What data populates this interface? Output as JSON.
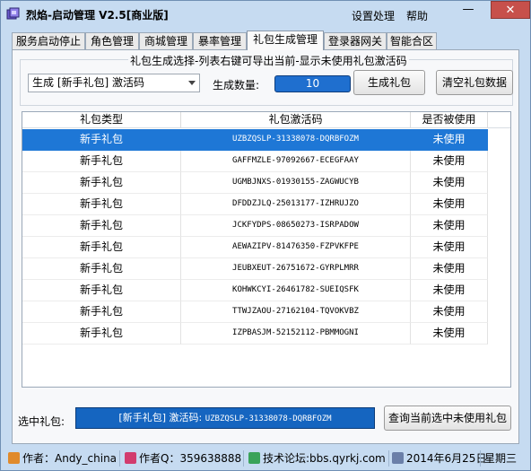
{
  "window": {
    "title": "烈焰-启动管理 V2.5[商业版]",
    "menu": [
      "设置处理",
      "帮助"
    ],
    "minimize_glyph": "—",
    "close_glyph": "✕"
  },
  "tabs": [
    {
      "label": "服务启动停止",
      "active": false
    },
    {
      "label": "角色管理",
      "active": false
    },
    {
      "label": "商城管理",
      "active": false
    },
    {
      "label": "暴率管理",
      "active": false
    },
    {
      "label": "礼包生成管理",
      "active": true
    },
    {
      "label": "登录器网关",
      "active": false
    },
    {
      "label": "智能合区",
      "active": false
    }
  ],
  "gift": {
    "group_title": "礼包生成选择-列表右键可导出当前-显示未使用礼包激活码",
    "type_selected": "生成 [新手礼包] 激活码",
    "qty_label": "生成数量:",
    "qty_value": "10",
    "generate_button": "生成礼包",
    "clear_button": "清空礼包数据"
  },
  "table": {
    "columns": [
      "礼包类型",
      "礼包激活码",
      "是否被使用"
    ],
    "rows": [
      {
        "type": "新手礼包",
        "code": "UZBZQSLP-31338078-DQRBFOZM",
        "used": "未使用"
      },
      {
        "type": "新手礼包",
        "code": "GAFFMZLE-97092667-ECEGFAAY",
        "used": "未使用"
      },
      {
        "type": "新手礼包",
        "code": "UGMBJNXS-01930155-ZAGWUCYB",
        "used": "未使用"
      },
      {
        "type": "新手礼包",
        "code": "DFDDZJLQ-25013177-IZHRUJZO",
        "used": "未使用"
      },
      {
        "type": "新手礼包",
        "code": "JCKFYDPS-08650273-ISRPADOW",
        "used": "未使用"
      },
      {
        "type": "新手礼包",
        "code": "AEWAZIPV-81476350-FZPVKFPE",
        "used": "未使用"
      },
      {
        "type": "新手礼包",
        "code": "JEUBXEUT-26751672-GYRPLMRR",
        "used": "未使用"
      },
      {
        "type": "新手礼包",
        "code": "KOHWKCYI-26461782-SUEIQSFK",
        "used": "未使用"
      },
      {
        "type": "新手礼包",
        "code": "TTWJZAOU-27162104-TQVOKVBZ",
        "used": "未使用"
      },
      {
        "type": "新手礼包",
        "code": "IZPBASJM-52152112-PBMMOGNI",
        "used": "未使用"
      }
    ],
    "selected_row": 0
  },
  "selection": {
    "label": "选中礼包:",
    "value_prefix": "[新手礼包] 激活码:",
    "value_code": "UZBZQSLP-31338078-DQRBFOZM",
    "query_button": "查询当前选中未使用礼包"
  },
  "status": {
    "author": "作者：Andy_china",
    "qq": "作者Q：359638888",
    "forum": "技术论坛:bbs.qyrkj.com",
    "date": "2014年6月25日",
    "weekday": "星期三"
  },
  "colors": {
    "selection": "#1e77d6",
    "field_blue": "#1565c0"
  }
}
